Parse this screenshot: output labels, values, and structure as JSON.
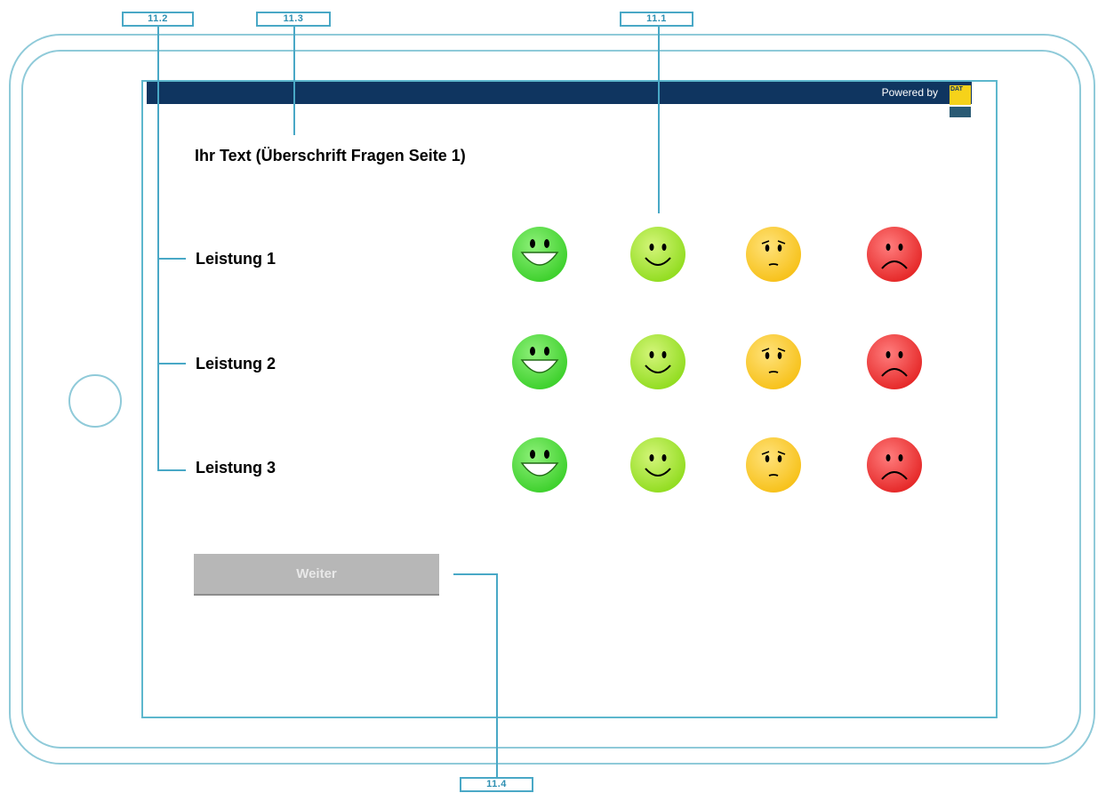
{
  "header": {
    "powered_by": "Powered by",
    "logo_text": "DAT"
  },
  "page": {
    "heading": "Ihr Text (Überschrift Fragen Seite 1)"
  },
  "rows": [
    {
      "label": "Leistung 1"
    },
    {
      "label": "Leistung 2"
    },
    {
      "label": "Leistung 3"
    }
  ],
  "rating_options": [
    {
      "icon": "very-happy-smiley-icon",
      "color": "#3fd12e"
    },
    {
      "icon": "happy-smiley-icon",
      "color": "#93dd22"
    },
    {
      "icon": "worried-smiley-icon",
      "color": "#f7c21c"
    },
    {
      "icon": "sad-smiley-icon",
      "color": "#e62a2a"
    }
  ],
  "button": {
    "next_label": "Weiter"
  },
  "annotations": {
    "a11_1": "11.1",
    "a11_2": "11.2",
    "a11_3": "11.3",
    "a11_4": "11.4"
  },
  "colors": {
    "header_bar": "#0f3560",
    "annotation": "#49a8c6",
    "button_bg": "#b7b7b7"
  }
}
